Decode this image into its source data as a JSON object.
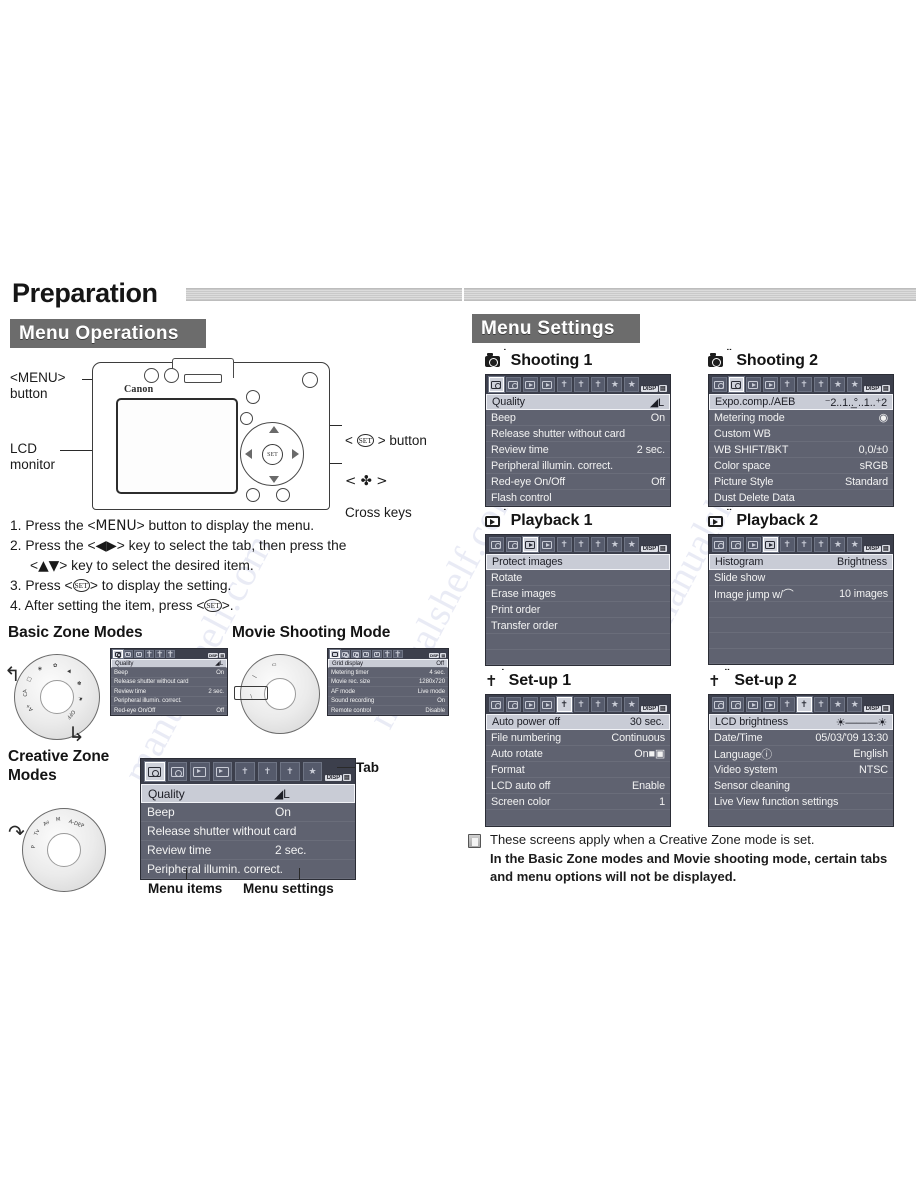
{
  "page": {
    "title": "Preparation",
    "watermark": "manualshelf.com"
  },
  "left": {
    "band_label": "Menu Operations",
    "camera_labels": {
      "menu_button": "<MENU>\nbutton",
      "lcd_monitor": "LCD\nmonitor",
      "set_button_prefix": "< ",
      "set_button_glyph": "SET",
      "set_button_suffix": " > button",
      "cross_keys_prefix": "< ✤ >",
      "cross_keys_label": "Cross keys",
      "brand": "Canon"
    },
    "steps": [
      "1. Press the <MENU> button to display the menu.",
      "2. Press the <◀▶> key to select the tab, then press the <▲▼> key to select the desired item.",
      "3. Press <SET> to display the setting.",
      "4. After setting the item, press <SET>."
    ],
    "step_parts": {
      "s1_a": "1. Press the <",
      "s1_menu": "MENU",
      "s1_b": "> button to display the menu.",
      "s2_a": "2. Press the <",
      "s2_keys": "◀▶",
      "s2_b": "> key to select the tab, then press the",
      "s2_c_a": "<",
      "s2_c_keys": "▲▼",
      "s2_c_b": "> key to select the desired item.",
      "s3_a": "3. Press <",
      "s3_set": "SET",
      "s3_b": "> to display the setting.",
      "s4_a": "4. After setting the item, press <",
      "s4_set": "SET",
      "s4_b": ">."
    },
    "basic_zone_heading": "Basic Zone Modes",
    "movie_heading": "Movie Shooting Mode",
    "creative_zone_heading": "Creative Zone\nModes",
    "caption_menu_items": "Menu items",
    "caption_menu_settings": "Menu settings",
    "caption_tab": "Tab",
    "basic_zone_screen": {
      "tabs": [
        "shooting1",
        "playback1",
        "playback2",
        "setup1",
        "setup2",
        "setup3"
      ],
      "active_tab_index": 0,
      "disp_badge": "DISP",
      "rows": [
        {
          "key": "Quality",
          "value": "◢L",
          "selected": true
        },
        {
          "key": "Beep",
          "value": "On"
        },
        {
          "key": "Release shutter without card",
          "value": ""
        },
        {
          "key": "Review time",
          "value": "2 sec."
        },
        {
          "key": "Peripheral illumin. correct.",
          "value": ""
        },
        {
          "key": "Red-eye On/Off",
          "value": "Off"
        }
      ]
    },
    "movie_screen": {
      "tabs": [
        "movie1",
        "shooting1",
        "shooting2",
        "playback1",
        "playback2",
        "setup1",
        "setup2"
      ],
      "active_tab_index": 0,
      "disp_badge": "DISP",
      "rows": [
        {
          "key": "Grid display",
          "value": "Off",
          "selected": true
        },
        {
          "key": "Metering timer",
          "value": "4 sec."
        },
        {
          "key": "Movie rec. size",
          "value": "1280x720"
        },
        {
          "key": "AF mode",
          "value": "Live mode"
        },
        {
          "key": "Sound recording",
          "value": "On"
        },
        {
          "key": "Remote control",
          "value": "Disable"
        }
      ]
    },
    "creative_zone_screen": {
      "tabs": [
        "shooting1",
        "shooting2",
        "playback1",
        "playback2",
        "setup1",
        "setup2",
        "setup3",
        "mymenu"
      ],
      "active_tab_index": 0,
      "disp_badge": "DISP",
      "rows": [
        {
          "key": "Quality",
          "value": "◢L",
          "selected": true
        },
        {
          "key": "Beep",
          "value": "On"
        },
        {
          "key": "Release shutter without card",
          "value": ""
        },
        {
          "key": "Review time",
          "value": "2 sec."
        },
        {
          "key": "Peripheral illumin. correct.",
          "value": ""
        }
      ]
    },
    "dial_marks_basic": [
      "A+",
      "CA",
      "□",
      "❀",
      "✿",
      "⛰",
      "✽",
      "⚑",
      "OFF"
    ],
    "dial_marks_movie": [
      "—",
      "|",
      "▭"
    ],
    "dial_marks_creative": [
      "P",
      "Tv",
      "Av",
      "M",
      "A-DEP"
    ]
  },
  "right": {
    "band_label": "Menu Settings",
    "panels": [
      {
        "id": "shooting1",
        "heading": "Shooting 1",
        "icon": "camera-icon",
        "icon_dots": "˙",
        "active_tab_index": 0,
        "tab_count": 9,
        "disp_badge": "DISP",
        "rows": [
          {
            "key": "Quality",
            "value": "◢L",
            "selected": true
          },
          {
            "key": "Beep",
            "value": "On"
          },
          {
            "key": "Release shutter without card",
            "value": ""
          },
          {
            "key": "Review time",
            "value": "2 sec."
          },
          {
            "key": "Peripheral illumin. correct.",
            "value": ""
          },
          {
            "key": "Red-eye On/Off",
            "value": "Off"
          },
          {
            "key": "Flash control",
            "value": ""
          }
        ]
      },
      {
        "id": "shooting2",
        "heading": "Shooting 2",
        "icon": "camera-icon",
        "icon_dots": "˙˙",
        "active_tab_index": 1,
        "tab_count": 9,
        "disp_badge": "DISP",
        "rows": [
          {
            "key": "Expo.comp./AEB",
            "value": "⁻2..1..̲°..1..⁺2",
            "selected": true
          },
          {
            "key": "Metering mode",
            "value": "◉"
          },
          {
            "key": "Custom WB",
            "value": ""
          },
          {
            "key": "WB SHIFT/BKT",
            "value": "0,0/±0"
          },
          {
            "key": "Color space",
            "value": "sRGB"
          },
          {
            "key": "Picture Style",
            "value": "Standard"
          },
          {
            "key": "Dust Delete Data",
            "value": ""
          }
        ]
      },
      {
        "id": "playback1",
        "heading": "Playback 1",
        "icon": "playback-icon",
        "icon_dots": "˙",
        "active_tab_index": 2,
        "tab_count": 9,
        "disp_badge": "DISP",
        "rows": [
          {
            "key": "Protect images",
            "value": "",
            "selected": true
          },
          {
            "key": "Rotate",
            "value": ""
          },
          {
            "key": "Erase images",
            "value": ""
          },
          {
            "key": "Print order",
            "value": ""
          },
          {
            "key": "Transfer order",
            "value": ""
          }
        ]
      },
      {
        "id": "playback2",
        "heading": "Playback 2",
        "icon": "playback-icon",
        "icon_dots": "˙˙",
        "active_tab_index": 3,
        "tab_count": 9,
        "disp_badge": "DISP",
        "rows": [
          {
            "key": "Histogram",
            "value": "Brightness",
            "selected": true
          },
          {
            "key": "Slide show",
            "value": ""
          },
          {
            "key": "Image jump w/⌒",
            "value": "10 images"
          }
        ]
      },
      {
        "id": "setup1",
        "heading": "Set-up 1",
        "icon": "wrench-icon",
        "icon_dots": "˙",
        "active_tab_index": 4,
        "tab_count": 9,
        "disp_badge": "DISP",
        "rows": [
          {
            "key": "Auto power off",
            "value": "30 sec.",
            "selected": true
          },
          {
            "key": "File numbering",
            "value": "Continuous"
          },
          {
            "key": "Auto rotate",
            "value": "On■▣"
          },
          {
            "key": "Format",
            "value": ""
          },
          {
            "key": "LCD auto off",
            "value": "Enable"
          },
          {
            "key": "Screen color",
            "value": "1"
          }
        ]
      },
      {
        "id": "setup2",
        "heading": "Set-up 2",
        "icon": "wrench-icon",
        "icon_dots": "˙˙",
        "active_tab_index": 5,
        "tab_count": 9,
        "disp_badge": "DISP",
        "rows": [
          {
            "key": "LCD brightness",
            "value": "☀———☀",
            "selected": true
          },
          {
            "key": "Date/Time",
            "value": "05/03/'09 13:30"
          },
          {
            "key": "Languageⓘ",
            "value": "English"
          },
          {
            "key": "Video system",
            "value": "NTSC"
          },
          {
            "key": "Sensor cleaning",
            "value": ""
          },
          {
            "key": "Live View function settings",
            "value": ""
          }
        ]
      }
    ],
    "note": {
      "icon": "note-icon",
      "line1": "These screens apply when a Creative Zone mode is set.",
      "line2": "In the Basic Zone modes and Movie shooting mode, certain tabs",
      "line3": "and menu options will not be displayed."
    }
  }
}
